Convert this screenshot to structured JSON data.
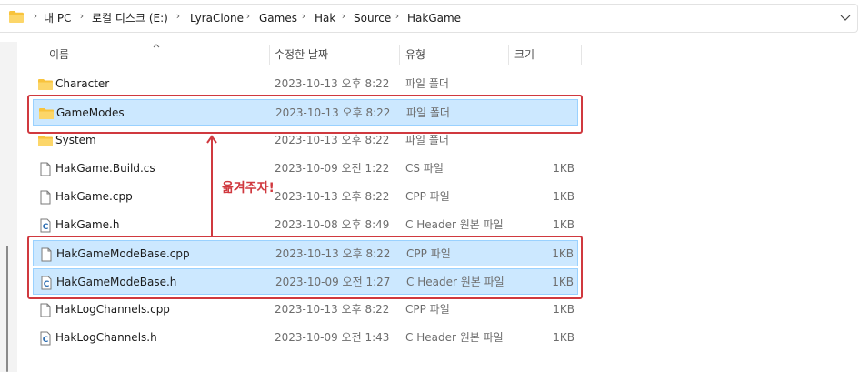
{
  "breadcrumb": [
    "내 PC",
    "로컬 디스크 (E:)",
    "LyraClone",
    "Games",
    "Hak",
    "Source",
    "HakGame"
  ],
  "columns": {
    "name": "이름",
    "date": "수정한 날짜",
    "type": "유형",
    "size": "크기"
  },
  "files": [
    {
      "name": "Character",
      "date": "2023-10-13 오후 8:22",
      "type": "파일 폴더",
      "size": "",
      "icon": "folder-icon",
      "selected": false
    },
    {
      "name": "GameModes",
      "date": "2023-10-13 오후 8:22",
      "type": "파일 폴더",
      "size": "",
      "icon": "folder-icon",
      "selected": true
    },
    {
      "name": "System",
      "date": "2023-10-13 오후 8:22",
      "type": "파일 폴더",
      "size": "",
      "icon": "folder-icon",
      "selected": false
    },
    {
      "name": "HakGame.Build.cs",
      "date": "2023-10-09 오전 1:22",
      "type": "CS 파일",
      "size": "1KB",
      "icon": "file-icon",
      "selected": false
    },
    {
      "name": "HakGame.cpp",
      "date": "2023-10-13 오후 8:22",
      "type": "CPP 파일",
      "size": "1KB",
      "icon": "file-icon",
      "selected": false
    },
    {
      "name": "HakGame.h",
      "date": "2023-10-08 오후 8:49",
      "type": "C Header 원본 파일",
      "size": "1KB",
      "icon": "c-header-icon",
      "selected": false
    },
    {
      "name": "HakGameModeBase.cpp",
      "date": "2023-10-13 오후 8:22",
      "type": "CPP 파일",
      "size": "1KB",
      "icon": "file-icon",
      "selected": true
    },
    {
      "name": "HakGameModeBase.h",
      "date": "2023-10-09 오전 1:27",
      "type": "C Header 원본 파일",
      "size": "1KB",
      "icon": "c-header-icon",
      "selected": true
    },
    {
      "name": "HakLogChannels.cpp",
      "date": "2023-10-13 오후 8:22",
      "type": "CPP 파일",
      "size": "1KB",
      "icon": "file-icon",
      "selected": false
    },
    {
      "name": "HakLogChannels.h",
      "date": "2023-10-09 오전 1:43",
      "type": "C Header 원본 파일",
      "size": "1KB",
      "icon": "c-header-icon",
      "selected": false
    }
  ],
  "annotation": {
    "text": "옮겨주자!",
    "color": "#d0393f"
  },
  "colors": {
    "selection": "#cce8ff",
    "selection_border": "#99d1ff",
    "folder": "#f8c33c",
    "accent": "#d0393f"
  }
}
